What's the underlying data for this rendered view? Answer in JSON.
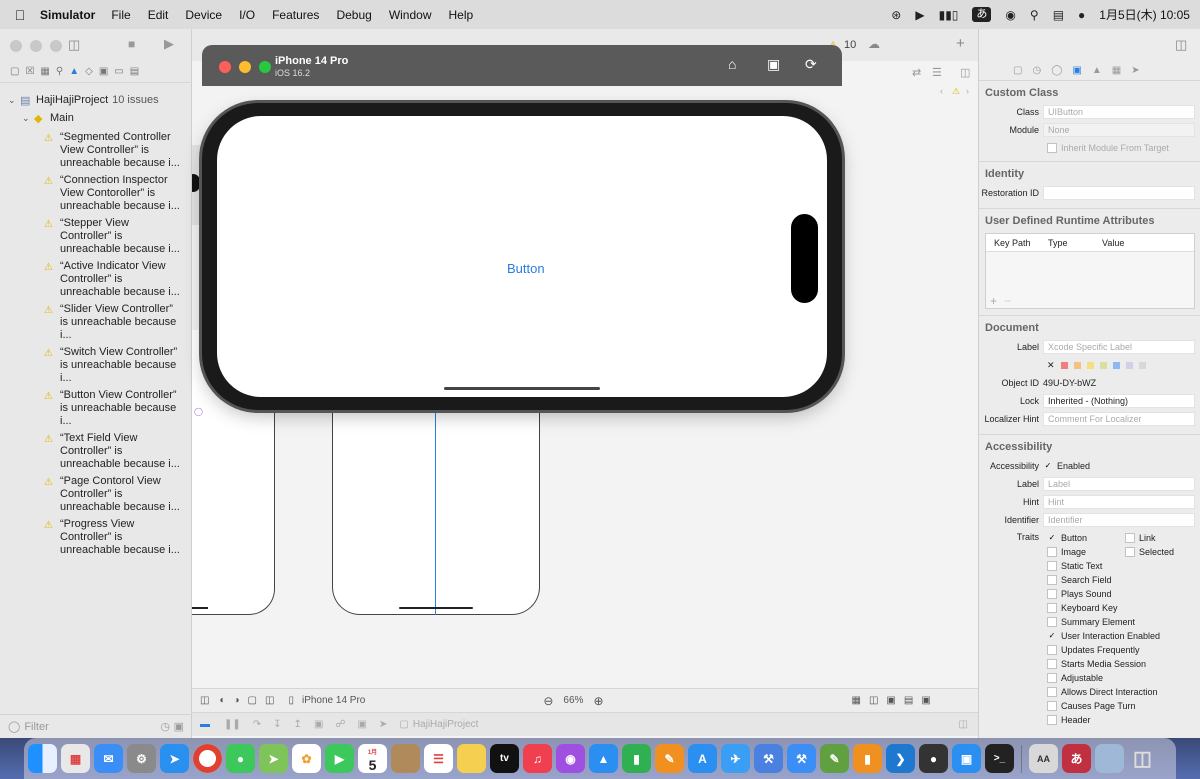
{
  "menubar": {
    "app_name": "Simulator",
    "menus": [
      "File",
      "Edit",
      "Device",
      "I/O",
      "Features",
      "Debug",
      "Window",
      "Help"
    ],
    "ime": "あ",
    "clock": "1月5日(木) 10:05"
  },
  "navigator": {
    "project_name": "HajiHajiProject",
    "issue_count": "10 issues",
    "group": "Main",
    "issues": [
      "“Segmented Controller View Controller” is unreachable because i...",
      "“Connection Inspector View Contoroller” is unreachable because i...",
      "“Stepper View Controller” is unreachable because i...",
      "“Active Indicator View Controller” is unreachable because i...",
      "“Slider View Controller” is unreachable because i...",
      "“Switch View Controller” is unreachable because i...",
      "“Button View Controller” is unreachable because i...",
      "“Text Field View Controller” is unreachable because i...",
      "“Page Contorol View Controller” is unreachable because i...",
      "“Progress View Controller” is unreachable because i..."
    ],
    "filter_placeholder": "Filter"
  },
  "editor": {
    "issue_badge": "10",
    "canvas_device": "iPhone 14 Pro",
    "zoom": "66%",
    "debug_target": "HajiHajiProject"
  },
  "simulator": {
    "title": "iPhone 14 Pro",
    "os": "iOS 16.2",
    "button_label": "Button"
  },
  "inspector": {
    "custom_class": {
      "heading": "Custom Class",
      "class_label": "Class",
      "class_placeholder": "UIButton",
      "module_label": "Module",
      "module_placeholder": "None",
      "inherit_label": "Inherit Module From Target"
    },
    "identity": {
      "heading": "Identity",
      "restoration_label": "Restoration ID"
    },
    "runtime": {
      "heading": "User Defined Runtime Attributes",
      "col_keypath": "Key Path",
      "col_type": "Type",
      "col_value": "Value"
    },
    "document": {
      "heading": "Document",
      "label_label": "Label",
      "label_placeholder": "Xcode Specific Label",
      "object_id_label": "Object ID",
      "object_id": "49U-DY-bWZ",
      "lock_label": "Lock",
      "lock_value": "Inherited - (Nothing)",
      "hint_label": "Localizer Hint",
      "hint_placeholder": "Comment For Localizer"
    },
    "accessibility": {
      "heading": "Accessibility",
      "acc_label": "Accessibility",
      "enabled": "Enabled",
      "label_label": "Label",
      "label_placeholder": "Label",
      "hint_label": "Hint",
      "hint_placeholder": "Hint",
      "identifier_label": "Identifier",
      "identifier_placeholder": "Identifier",
      "traits_label": "Traits",
      "traits_col1": [
        {
          "name": "Button",
          "checked": true
        },
        {
          "name": "Image",
          "checked": false
        },
        {
          "name": "Static Text",
          "checked": false
        },
        {
          "name": "Search Field",
          "checked": false
        },
        {
          "name": "Plays Sound",
          "checked": false
        },
        {
          "name": "Keyboard Key",
          "checked": false
        },
        {
          "name": "Summary Element",
          "checked": false
        },
        {
          "name": "User Interaction Enabled",
          "checked": true
        },
        {
          "name": "Updates Frequently",
          "checked": false
        },
        {
          "name": "Starts Media Session",
          "checked": false
        },
        {
          "name": "Adjustable",
          "checked": false
        },
        {
          "name": "Allows Direct Interaction",
          "checked": false
        },
        {
          "name": "Causes Page Turn",
          "checked": false
        },
        {
          "name": "Header",
          "checked": false
        }
      ],
      "traits_col2": [
        {
          "name": "Link",
          "checked": false
        },
        {
          "name": "Selected",
          "checked": false
        }
      ]
    }
  },
  "dock": {
    "calendar_month": "1月",
    "calendar_day": "5",
    "tv_label": "tv"
  },
  "colors": {
    "accent_blue": "#2a7ee0",
    "warning_yellow": "#e3b400",
    "traffic_red": "#ff5f57",
    "traffic_yellow": "#febc2e",
    "traffic_green": "#28c840"
  }
}
